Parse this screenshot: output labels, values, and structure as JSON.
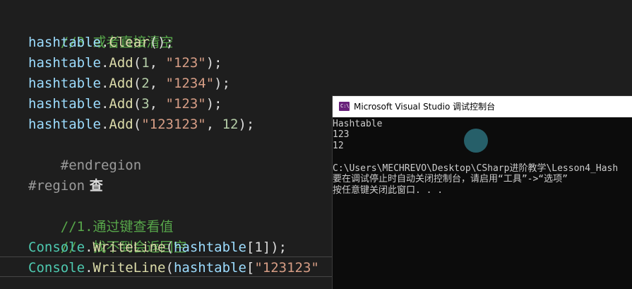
{
  "code": {
    "lines": [
      {
        "comment": "//3.或者直接清空"
      },
      {
        "var": "hashtable",
        "dot": ".",
        "method": "Clear",
        "rest": "();"
      },
      {
        "var": "hashtable",
        "dot": ".",
        "method": "Add",
        "open": "(",
        "arg1": "1",
        "sep": ", ",
        "arg2": "\"123\"",
        "close": ");"
      },
      {
        "var": "hashtable",
        "dot": ".",
        "method": "Add",
        "open": "(",
        "arg1": "2",
        "sep": ", ",
        "arg2": "\"1234\"",
        "close": ");"
      },
      {
        "var": "hashtable",
        "dot": ".",
        "method": "Add",
        "open": "(",
        "arg1": "3",
        "sep": ", ",
        "arg2": "\"123\"",
        "close": ");"
      },
      {
        "var": "hashtable",
        "dot": ".",
        "method": "Add",
        "open": "(",
        "arg1": "\"123123\"",
        "sep": ", ",
        "arg2": "12",
        "close": ");"
      },
      {
        "directive": "#endregion"
      },
      {},
      {
        "directive": "#region",
        "name": " 查"
      },
      {
        "comment": "//1.通过键查看值"
      },
      {
        "comment": "//  找不到会返回空"
      },
      {
        "cls": "Console",
        "dot": ".",
        "method": "WriteLine",
        "open": "(",
        "var": "hashtable",
        "idx": "[1]",
        "close": ");"
      },
      {
        "cls": "Console",
        "dot": ".",
        "method": "WriteLine",
        "open": "(",
        "var": "hashtable",
        "idxopen": "[",
        "str": "\"123123\"",
        "close": ""
      }
    ]
  },
  "console_window": {
    "title": "Microsoft Visual Studio 调试控制台",
    "icon": "vs-console-icon",
    "output": [
      "Hashtable",
      "123",
      "12",
      "",
      "C:\\Users\\MECHREVO\\Desktop\\CSharp进阶教学\\Lesson4_Hash",
      "要在调试停止时自动关闭控制台，请启用“工具”->“选项”",
      "按任意键关闭此窗口. . ."
    ]
  },
  "colors": {
    "editor_bg": "#1e1e1e",
    "console_bg": "#0c0c0c",
    "comment": "#57a64a",
    "string": "#d69d85",
    "method": "#dcdcaa",
    "class": "#4ec9b0"
  }
}
